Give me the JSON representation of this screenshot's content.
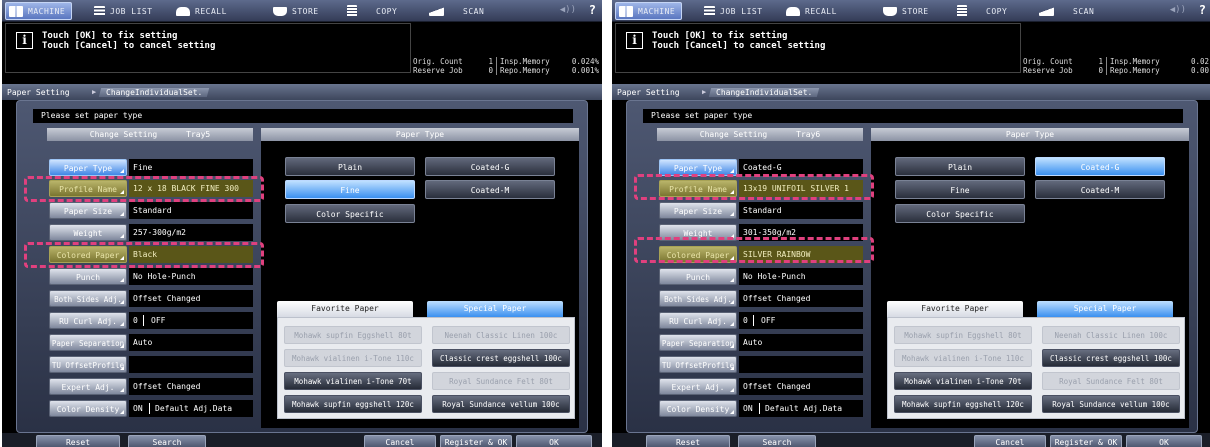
{
  "tabs": [
    {
      "label": "MACHINE",
      "icon": "machine-icon"
    },
    {
      "label": "JOB LIST",
      "icon": "job-list-icon"
    },
    {
      "label": "RECALL",
      "icon": "recall-icon"
    },
    {
      "label": "STORE",
      "icon": "store-icon"
    },
    {
      "label": "COPY",
      "icon": "copy-icon"
    },
    {
      "label": "SCAN",
      "icon": "scan-icon"
    }
  ],
  "help_label": "?",
  "volume_label": "◀))",
  "message": {
    "line1": "Touch [OK] to fix setting",
    "line2": "Touch [Cancel] to cancel setting"
  },
  "info_icon_label": "i",
  "counts": {
    "orig_count_label": "Orig. Count",
    "reserve_job_label": "Reserve Job",
    "insp_memory_label": "Insp.Memory",
    "repo_memory_label": "Repo.Memory"
  },
  "breadcrumb": {
    "first": "Paper Setting",
    "second": "ChangeIndividualSet."
  },
  "prompt": "Please set paper type",
  "labels": {
    "change_setting": "Change Setting",
    "paper_type_header": "Paper Type",
    "paper_type": "Paper Type",
    "profile_name": "Profile Name",
    "paper_size": "Paper Size",
    "weight": "Weight",
    "colored_paper": "Colored Paper",
    "punch": "Punch",
    "both_sides_adj": "Both Sides Adj.",
    "ru_curl_adj": "RU Curl Adj.",
    "paper_separation": "Paper Separation",
    "tu_offset_profile": "TU OffsetProfile",
    "expert_adj": "Expert Adj.",
    "color_density": "Color Density"
  },
  "paper_type_buttons": {
    "plain": "Plain",
    "fine": "Fine",
    "color_specific": "Color Specific",
    "coated_g": "Coated-G",
    "coated_m": "Coated-M"
  },
  "favorite_tab": "Favorite Paper",
  "special_tab": "Special Paper",
  "special_papers": [
    "Mohawk supfin Eggshell 80t",
    "Neenah Classic Linen 100c",
    "Mohawk vialinen i-Tone 110c",
    "Classic crest eggshell 100c",
    "Mohawk vialinen i-Tone 70t",
    "Royal Sundance Felt 80t",
    "Mohawk supfin eggshell 120c",
    "Royal Sundance vellum 100c"
  ],
  "bottom": {
    "reset": "Reset",
    "search": "Search",
    "cancel": "Cancel",
    "register_ok": "Register & OK",
    "ok": "OK"
  },
  "screens": [
    {
      "tray": "Tray5",
      "orig_count": "1",
      "reserve_job": "0",
      "insp_memory": "0.024%",
      "repo_memory": "0.001%",
      "selected_type": "Fine",
      "values": {
        "paper_type": "Fine",
        "profile_name": "12 x 18 BLACK FINE 300",
        "paper_size": "Standard",
        "weight": "257-300g/m2",
        "colored_paper": "Black",
        "punch": "No Hole-Punch",
        "both_sides_adj": "Offset Changed",
        "ru_curl_adj_a": "0",
        "ru_curl_adj_b": "OFF",
        "paper_separation": "Auto",
        "tu_offset_profile": "",
        "expert_adj": "Offset Changed",
        "color_density_a": "ON",
        "color_density_b": "Default Adj.Data"
      }
    },
    {
      "tray": "Tray6",
      "orig_count": "1",
      "reserve_job": "0",
      "insp_memory": "0.02",
      "repo_memory": "0.00",
      "selected_type": "Coated-G",
      "values": {
        "paper_type": "Coated-G",
        "profile_name": "13x19 UNIFOIL SILVER 1",
        "paper_size": "Standard",
        "weight": "301-350g/m2",
        "colored_paper": "SILVER RAINBOW",
        "punch": "No Hole-Punch",
        "both_sides_adj": "Offset Changed",
        "ru_curl_adj_a": "0",
        "ru_curl_adj_b": "OFF",
        "paper_separation": "Auto",
        "tu_offset_profile": "",
        "expert_adj": "Offset Changed",
        "color_density_a": "ON",
        "color_density_b": "Default Adj.Data"
      }
    }
  ],
  "colors": {
    "highlight": "#e0407e",
    "active_blue": "#3a90f0",
    "olive": "#7a7530"
  }
}
